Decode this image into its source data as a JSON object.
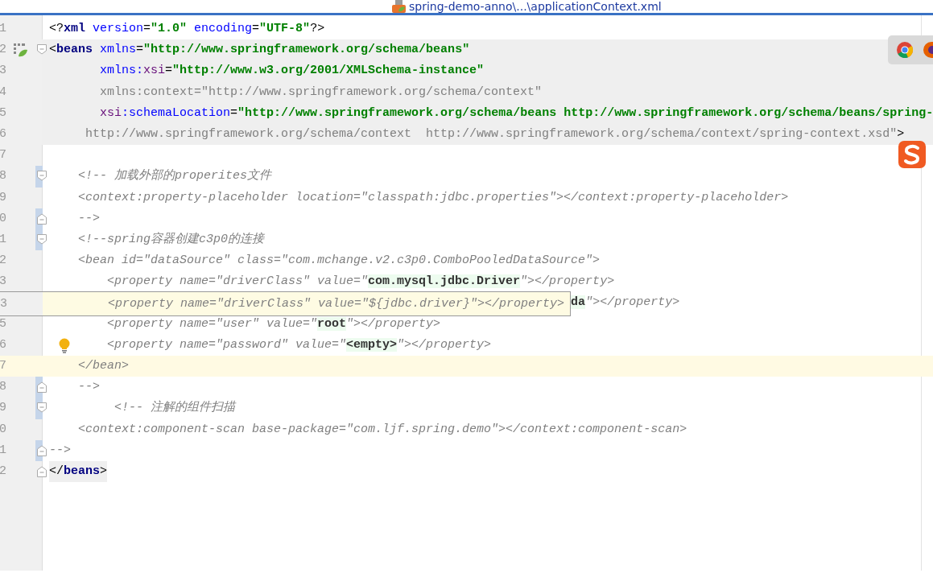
{
  "title_bar": {
    "file_path": "spring-demo-anno\\...\\applicationContext.xml"
  },
  "editor": {
    "lines": [
      {
        "number": "1",
        "tag_range": false,
        "tag_match": false,
        "current": false,
        "intention": false,
        "segments": [
          {
            "kind": "punct",
            "text": "<?"
          },
          {
            "kind": "tag",
            "text": "xml"
          },
          {
            "kind": "attr",
            "text": " version"
          },
          {
            "kind": "punct",
            "text": "="
          },
          {
            "kind": "string",
            "text": "\"1.0\""
          },
          {
            "kind": "attr",
            "text": " encoding"
          },
          {
            "kind": "punct",
            "text": "="
          },
          {
            "kind": "string",
            "text": "\"UTF-8\""
          },
          {
            "kind": "punct",
            "text": "?>"
          }
        ]
      },
      {
        "number": "2",
        "tag_range": true,
        "tag_match": false,
        "current": false,
        "intention": false,
        "gutter_icon": {
          "kind": "bean"
        },
        "fold_marker": {
          "kind": "start",
          "marked": false
        },
        "segments": [
          {
            "kind": "punct",
            "text": "<"
          },
          {
            "kind": "tag",
            "text": "beans"
          },
          {
            "kind": "attr",
            "text": " xmlns"
          },
          {
            "kind": "punct",
            "text": "="
          },
          {
            "kind": "string",
            "text": "\"http://www.springframework.org/schema/beans\""
          }
        ]
      },
      {
        "number": "3",
        "tag_range": true,
        "tag_match": false,
        "current": false,
        "intention": false,
        "segments": [
          {
            "kind": "attr",
            "text": "       xmlns:"
          },
          {
            "kind": "ns",
            "text": "xsi"
          },
          {
            "kind": "punct",
            "text": "="
          },
          {
            "kind": "string",
            "text": "\"http://www.w3.org/2001/XMLSchema-instance\""
          }
        ]
      },
      {
        "number": "4",
        "tag_range": true,
        "tag_match": false,
        "current": false,
        "intention": false,
        "segments": [
          {
            "kind": "unused",
            "text": "       xmlns:context=\"http://www.springframework.org/schema/context\""
          }
        ]
      },
      {
        "number": "5",
        "tag_range": true,
        "tag_match": false,
        "current": false,
        "intention": false,
        "segments": [
          {
            "kind": "ns",
            "text": "       xsi"
          },
          {
            "kind": "attr",
            "text": ":schemaLocation"
          },
          {
            "kind": "punct",
            "text": "="
          },
          {
            "kind": "string",
            "text": "\"http://www.springframework.org/schema/beans http://www.springframework.org/schema/beans/spring-"
          }
        ]
      },
      {
        "number": "6",
        "tag_range": true,
        "tag_match": false,
        "current": false,
        "intention": false,
        "segments": [
          {
            "kind": "unused",
            "text": "     http://www.springframework.org/schema/context  http://www.springframework.org/schema/context/spring-context.xsd\""
          },
          {
            "kind": "punct",
            "text": ">"
          }
        ]
      },
      {
        "number": "7",
        "tag_range": false,
        "current": false,
        "intention": false
      },
      {
        "number": "8",
        "tag_range": false,
        "tag_match": false,
        "current": false,
        "intention": false,
        "fold_marker": {
          "kind": "start",
          "marked": true
        },
        "segments": [
          {
            "kind": "comment",
            "text": "    <!-- 加载外部的properites文件"
          }
        ]
      },
      {
        "number": "9",
        "tag_range": false,
        "tag_match": false,
        "current": false,
        "intention": false,
        "segments": [
          {
            "kind": "comment",
            "text": "    <context:property-placeholder location=\"classpath:jdbc.properties\"></context:property-placeholder>"
          }
        ]
      },
      {
        "number": "0",
        "tag_range": false,
        "tag_match": false,
        "current": false,
        "intention": false,
        "fold_marker": {
          "kind": "end",
          "marked": true
        },
        "segments": [
          {
            "kind": "comment",
            "text": "    -->"
          }
        ]
      },
      {
        "number": "1",
        "tag_range": false,
        "tag_match": false,
        "current": false,
        "intention": false,
        "fold_marker": {
          "kind": "start",
          "marked": true
        },
        "segments": [
          {
            "kind": "comment",
            "text": "    <!--spring容器创建c3p0的连接"
          }
        ]
      },
      {
        "number": "2",
        "tag_range": false,
        "tag_match": false,
        "current": false,
        "intention": false,
        "segments": [
          {
            "kind": "comment",
            "text": "    <bean id=\"dataSource\" class=\"com.mchange.v2.c3p0.ComboPooledDataSource\">"
          }
        ]
      },
      {
        "number": "3",
        "tag_range": false,
        "tag_match": false,
        "current": false,
        "intention": false,
        "segments": [
          {
            "kind": "comment",
            "text": "        <property name=\"driverClass\" value=\""
          },
          {
            "kind": "strong",
            "text": "com.mysql.jdbc.Driver"
          },
          {
            "kind": "comment",
            "text": "\"></property>"
          }
        ]
      },
      {
        "tag_range": false,
        "tag_match": false,
        "current": false,
        "intention": false,
        "segments": [
          {
            "kind": "strong",
            "text": "                                                                        da"
          },
          {
            "kind": "comment",
            "text": "\"></property>"
          }
        ]
      },
      {
        "number": "5",
        "tag_range": false,
        "tag_match": false,
        "current": false,
        "intention": false,
        "segments": [
          {
            "kind": "comment",
            "text": "        <property name=\"user\" value=\""
          },
          {
            "kind": "strong",
            "text": "root"
          },
          {
            "kind": "comment",
            "text": "\"></property>"
          }
        ]
      },
      {
        "number": "6",
        "tag_range": false,
        "tag_match": false,
        "current": false,
        "intention": true,
        "segments": [
          {
            "kind": "comment",
            "text": "        <property name=\"password\" value=\""
          },
          {
            "kind": "strong",
            "text": "<empty>"
          },
          {
            "kind": "comment",
            "text": "\"></property>"
          }
        ]
      },
      {
        "number": "7",
        "tag_range": false,
        "tag_match": false,
        "current": true,
        "intention": false,
        "segments": [
          {
            "kind": "comment",
            "text": "    </bean>"
          }
        ]
      },
      {
        "number": "8",
        "tag_range": false,
        "tag_match": false,
        "current": false,
        "intention": false,
        "fold_marker": {
          "kind": "end",
          "marked": true
        },
        "segments": [
          {
            "kind": "comment",
            "text": "    -->"
          }
        ]
      },
      {
        "number": "9",
        "tag_range": false,
        "tag_match": false,
        "current": false,
        "intention": false,
        "fold_marker": {
          "kind": "start",
          "marked": true
        },
        "segments": [
          {
            "kind": "comment",
            "text": "         <!-- 注解的组件扫描"
          }
        ]
      },
      {
        "number": "0",
        "tag_range": false,
        "tag_match": false,
        "current": false,
        "intention": false,
        "segments": [
          {
            "kind": "comment",
            "text": "    <context:component-scan base-package=\"com.ljf.spring.demo\"></context:component-scan>"
          }
        ]
      },
      {
        "number": "1",
        "tag_range": false,
        "tag_match": false,
        "current": false,
        "intention": false,
        "fold_marker": {
          "kind": "end",
          "marked": true
        },
        "segments": [
          {
            "kind": "comment",
            "text": "-->"
          }
        ]
      },
      {
        "number": "2",
        "tag_range": false,
        "tag_match": true,
        "current": false,
        "intention": false,
        "fold_marker": {
          "kind": "end",
          "marked": false
        },
        "segments": [
          {
            "kind": "punct",
            "text": "</"
          },
          {
            "kind": "tag",
            "text": "beans"
          },
          {
            "kind": "punct",
            "text": ">"
          }
        ]
      }
    ]
  },
  "tooltip": {
    "number": "3",
    "segments": [
      {
        "kind": "comment",
        "text": "        <property name=\"driverClass\" value=\"${jdbc.driver}\"></property>"
      }
    ]
  }
}
